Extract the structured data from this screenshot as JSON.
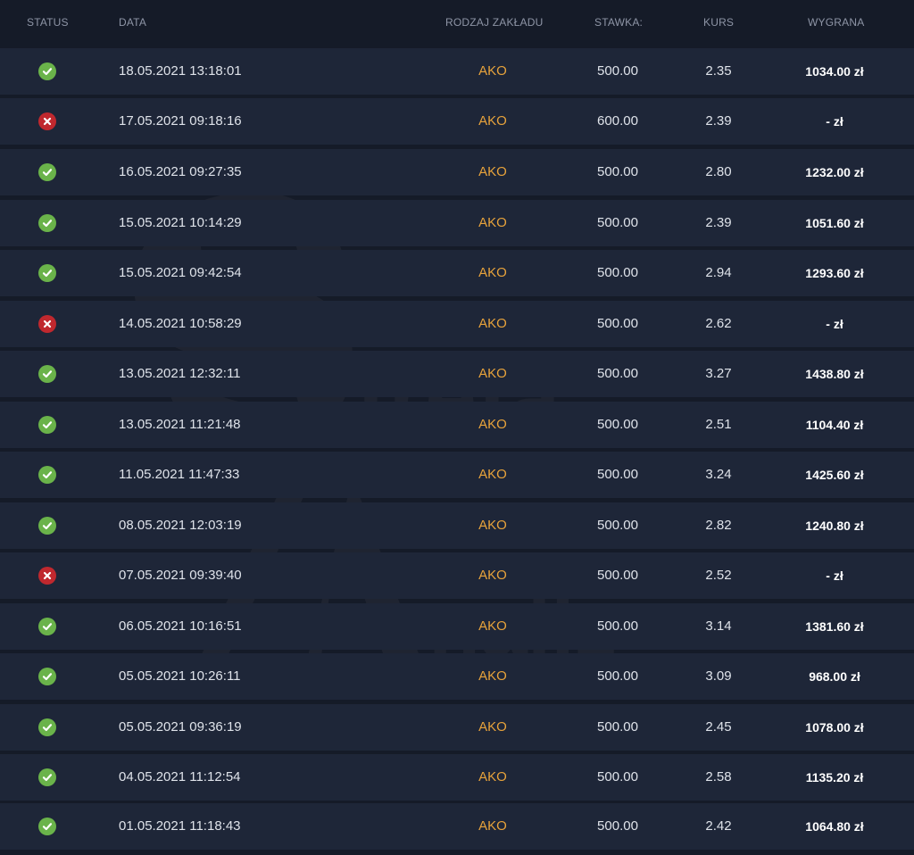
{
  "headers": {
    "status": "STATUS",
    "date": "DATA",
    "bet_type": "RODZAJ ZAKŁADU",
    "stake": "STAWKA:",
    "odds": "KURS",
    "win": "WYGRANA"
  },
  "colors": {
    "win_icon": "#6ab34a",
    "loss_icon": "#c0282e",
    "bet_type_text": "#e8a33b"
  },
  "rows": [
    {
      "status": "won",
      "date": "18.05.2021 13:18:01",
      "type": "AKO",
      "stake": "500.00",
      "odds": "2.35",
      "win": "1034.00 zł"
    },
    {
      "status": "lost",
      "date": "17.05.2021 09:18:16",
      "type": "AKO",
      "stake": "600.00",
      "odds": "2.39",
      "win": "- zł"
    },
    {
      "status": "won",
      "date": "16.05.2021 09:27:35",
      "type": "AKO",
      "stake": "500.00",
      "odds": "2.80",
      "win": "1232.00 zł"
    },
    {
      "status": "won",
      "date": "15.05.2021 10:14:29",
      "type": "AKO",
      "stake": "500.00",
      "odds": "2.39",
      "win": "1051.60 zł"
    },
    {
      "status": "won",
      "date": "15.05.2021 09:42:54",
      "type": "AKO",
      "stake": "500.00",
      "odds": "2.94",
      "win": "1293.60 zł"
    },
    {
      "status": "lost",
      "date": "14.05.2021 10:58:29",
      "type": "AKO",
      "stake": "500.00",
      "odds": "2.62",
      "win": "- zł"
    },
    {
      "status": "won",
      "date": "13.05.2021 12:32:11",
      "type": "AKO",
      "stake": "500.00",
      "odds": "3.27",
      "win": "1438.80 zł"
    },
    {
      "status": "won",
      "date": "13.05.2021 11:21:48",
      "type": "AKO",
      "stake": "500.00",
      "odds": "2.51",
      "win": "1104.40 zł"
    },
    {
      "status": "won",
      "date": "11.05.2021 11:47:33",
      "type": "AKO",
      "stake": "500.00",
      "odds": "3.24",
      "win": "1425.60 zł"
    },
    {
      "status": "won",
      "date": "08.05.2021 12:03:19",
      "type": "AKO",
      "stake": "500.00",
      "odds": "2.82",
      "win": "1240.80 zł"
    },
    {
      "status": "lost",
      "date": "07.05.2021 09:39:40",
      "type": "AKO",
      "stake": "500.00",
      "odds": "2.52",
      "win": "- zł"
    },
    {
      "status": "won",
      "date": "06.05.2021 10:16:51",
      "type": "AKO",
      "stake": "500.00",
      "odds": "3.14",
      "win": "1381.60 zł"
    },
    {
      "status": "won",
      "date": "05.05.2021 10:26:11",
      "type": "AKO",
      "stake": "500.00",
      "odds": "3.09",
      "win": "968.00 zł"
    },
    {
      "status": "won",
      "date": "05.05.2021 09:36:19",
      "type": "AKO",
      "stake": "500.00",
      "odds": "2.45",
      "win": "1078.00 zł"
    },
    {
      "status": "won",
      "date": "04.05.2021 11:12:54",
      "type": "AKO",
      "stake": "500.00",
      "odds": "2.58",
      "win": "1135.20 zł"
    },
    {
      "status": "won",
      "date": "01.05.2021 11:18:43",
      "type": "AKO",
      "stake": "500.00",
      "odds": "2.42",
      "win": "1064.80 zł"
    }
  ],
  "icons": {
    "won": "checkmark-icon",
    "lost": "x-icon"
  },
  "watermark": {
    "word1": "trefa",
    "word2": "naliz"
  }
}
